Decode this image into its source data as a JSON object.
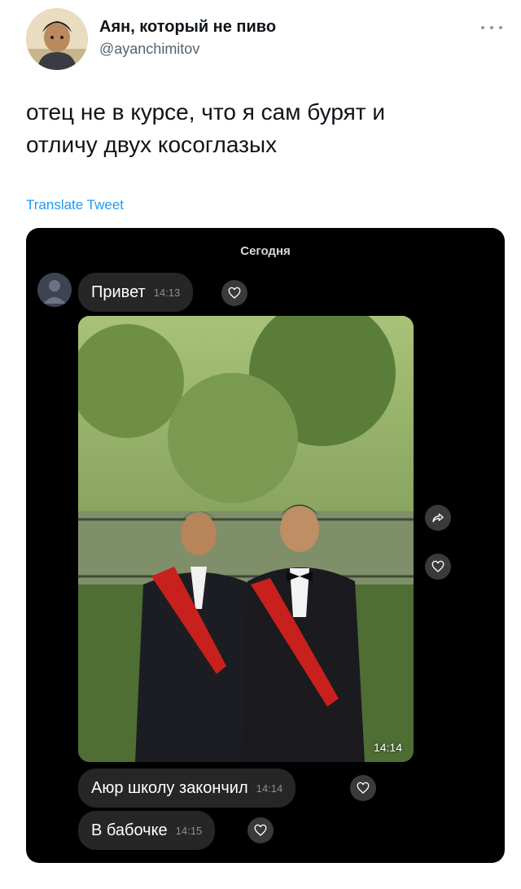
{
  "tweet": {
    "author_name": "Аян, который не пиво",
    "author_handle": "@ayanchimitov",
    "text_lines": [
      "отец не в курсе, что я сам бурят и",
      "отличу двух косоглазых"
    ],
    "translate_label": "Translate Tweet"
  },
  "icons": {
    "more": "more-horizontal-icon",
    "heart": "heart-icon",
    "share": "share-forward-icon",
    "profile": "profile-placeholder-icon"
  },
  "colors": {
    "link": "#1d9bf0",
    "dm_background": "#000000",
    "bubble": "#262626"
  },
  "dm": {
    "date_label": "Сегодня",
    "messages": [
      {
        "text": "Привет",
        "time": "14:13"
      },
      {
        "text": "Аюр школу закончил",
        "time": "14:14"
      },
      {
        "text": "В бабочке",
        "time": "14:15"
      }
    ],
    "photo_time": "14:14"
  }
}
